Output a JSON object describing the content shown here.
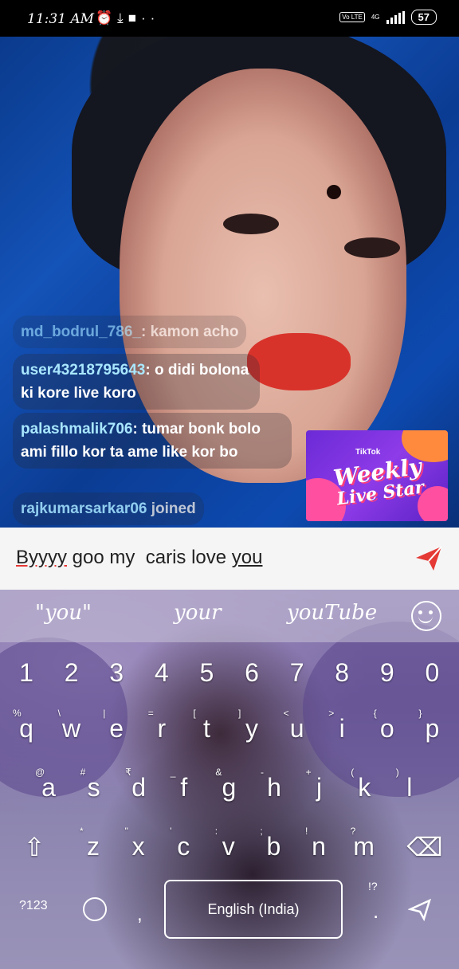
{
  "status_bar": {
    "time": "11:31 AM",
    "network_label": "Vo LTE",
    "signal_label": "4G",
    "battery": "57"
  },
  "comments": [
    {
      "user": "md_bodrul_786_",
      "text": "kamon acho"
    },
    {
      "user": "user43218795643",
      "text": "o didi bolona ki kore live koro"
    },
    {
      "user": "palashmalik706",
      "text": "tumar bonk bolo ami fillo kor ta ame like kor bo"
    },
    {
      "user": "rajkumarsarkar06",
      "text": "joined"
    }
  ],
  "promo": {
    "brand": "TikTok",
    "title_line1": "Weekly",
    "title_line2": "Live Star"
  },
  "input": {
    "word1": "Byyyy",
    "middle": " goo my  caris love ",
    "word2": "you"
  },
  "keyboard": {
    "suggestions": [
      "\"you\"",
      "your",
      "youTube"
    ],
    "number_row": [
      "1",
      "2",
      "3",
      "4",
      "5",
      "6",
      "7",
      "8",
      "9",
      "0"
    ],
    "row1": [
      "q",
      "w",
      "e",
      "r",
      "t",
      "y",
      "u",
      "i",
      "o",
      "p"
    ],
    "row1_hints": [
      "%",
      "\\",
      "|",
      "=",
      "[",
      "]",
      "<",
      ">",
      "{",
      "}"
    ],
    "row2": [
      "a",
      "s",
      "d",
      "f",
      "g",
      "h",
      "j",
      "k",
      "l"
    ],
    "row2_hints": [
      "@",
      "#",
      "₹",
      "_",
      "&",
      "-",
      "+",
      "(",
      ")"
    ],
    "row3": [
      "z",
      "x",
      "c",
      "v",
      "b",
      "n",
      "m"
    ],
    "row3_hints": [
      "*",
      "\"",
      "'",
      ":",
      ";",
      "!",
      "?"
    ],
    "symbols_key": "?123",
    "comma": ",",
    "space_label": "English (India)",
    "period": ".",
    "period_hint": "!?"
  },
  "colors": {
    "username": "#a9e7ff",
    "send_icon": "#e53935",
    "spell_underline": "#e53935"
  }
}
